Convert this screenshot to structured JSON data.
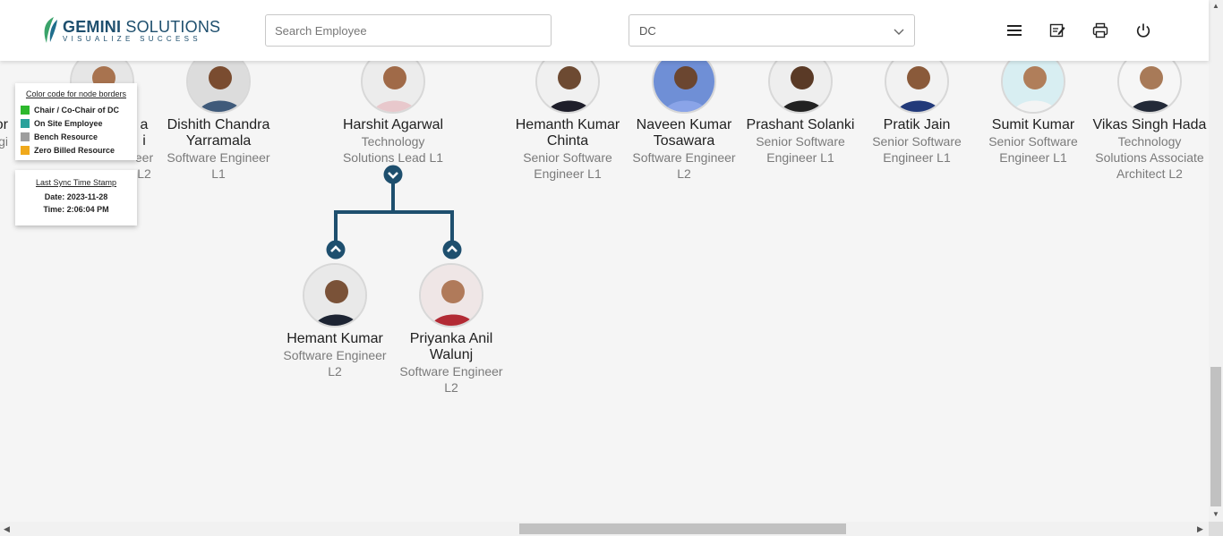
{
  "header": {
    "logo_main_bold": "GEMINI",
    "logo_main_rest": " SOLUTIONS",
    "logo_tagline": "VISUALIZE SUCCESS",
    "search_placeholder": "Search Employee",
    "filter_value": "DC",
    "icons": [
      "menu-icon",
      "edit-note-icon",
      "print-icon",
      "power-icon"
    ]
  },
  "legend": {
    "title": "Color code for node borders",
    "items": [
      {
        "label": "Chair / Co-Chair of DC",
        "color": "#2db82d"
      },
      {
        "label": "On Site Employee",
        "color": "#2aa19b"
      },
      {
        "label": "Bench Resource",
        "color": "#9e9e9e"
      },
      {
        "label": "Zero Billed Resource",
        "color": "#f0a91c"
      }
    ]
  },
  "sync": {
    "title": "Last Sync Time Stamp",
    "date": "Date: 2023-11-28",
    "time": "Time: 2:06:04 PM"
  },
  "nodes": [
    {
      "name": "Dishith Chandra Yarramala",
      "title": "Software Engineer L1"
    },
    {
      "name": "Harshit Agarwal",
      "title": "Technology Solutions Lead L1"
    },
    {
      "name": "Hemanth Kumar Chinta",
      "title": "Senior Software Engineer L1"
    },
    {
      "name": "Naveen Kumar Tosawara",
      "title": "Software Engineer L2"
    },
    {
      "name": "Prashant Solanki",
      "title": "Senior Software Engineer L1"
    },
    {
      "name": "Pratik Jain",
      "title": "Senior Software Engineer L1"
    },
    {
      "name": "Sumit Kumar",
      "title": "Senior Software Engineer L1"
    },
    {
      "name": "Vikas Singh Hada",
      "title": "Technology Solutions Associate Architect L2"
    }
  ],
  "children": [
    {
      "name": "Hemant Kumar",
      "title": "Software Engineer L2"
    },
    {
      "name": "Priyanka Anil Walunj",
      "title": "Software Engineer L2"
    }
  ],
  "partial": {
    "left_name_fragment": "ror",
    "left_title_fragment": "ngi",
    "second_name_fragment": "a",
    "second_name_fragment2": "i",
    "second_title_fragment": "eer",
    "second_title_fragment2": "L2"
  },
  "colors": {
    "brand": "#1e4f6e",
    "connector": "#1e4f6e"
  }
}
